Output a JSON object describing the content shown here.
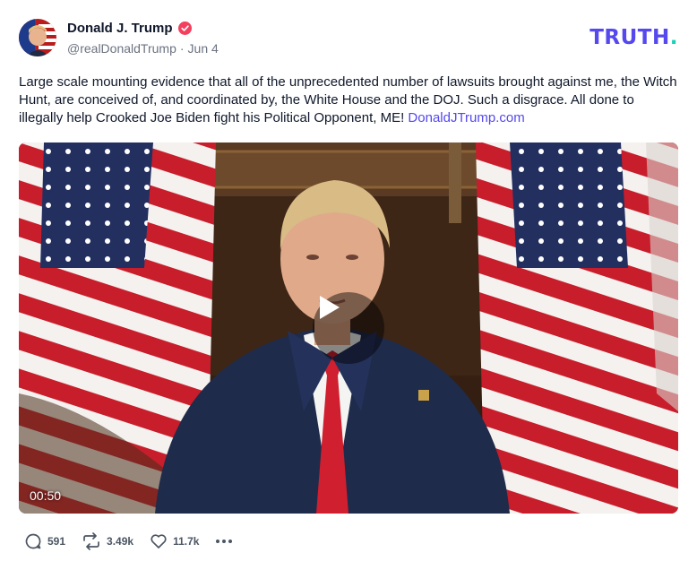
{
  "header": {
    "display_name": "Donald J. Trump",
    "handle": "@realDonaldTrump",
    "separator": "·",
    "date": "Jun 4",
    "logo_text": "TRUTH",
    "logo_dot": "."
  },
  "post": {
    "text": "Large scale mounting evidence that all of the unprecedented number of lawsuits brought against me, the Witch Hunt, are conceived of, and coordinated by, the White House and the DOJ. Such a disgrace. All done to illegally help Crooked Joe Biden fight his Political Opponent, ME! ",
    "link": "DonaldJTrump.com"
  },
  "video": {
    "duration": "00:50",
    "play_icon": "play-icon"
  },
  "actions": {
    "replies": "591",
    "retruths": "3.49k",
    "likes": "11.7k",
    "more_icon": "more-icon"
  },
  "colors": {
    "brand": "#5448ee",
    "brand_dot": "#17d2b8",
    "verified": "#f43f5e",
    "text": "#0f172a",
    "muted": "#6b7280"
  }
}
